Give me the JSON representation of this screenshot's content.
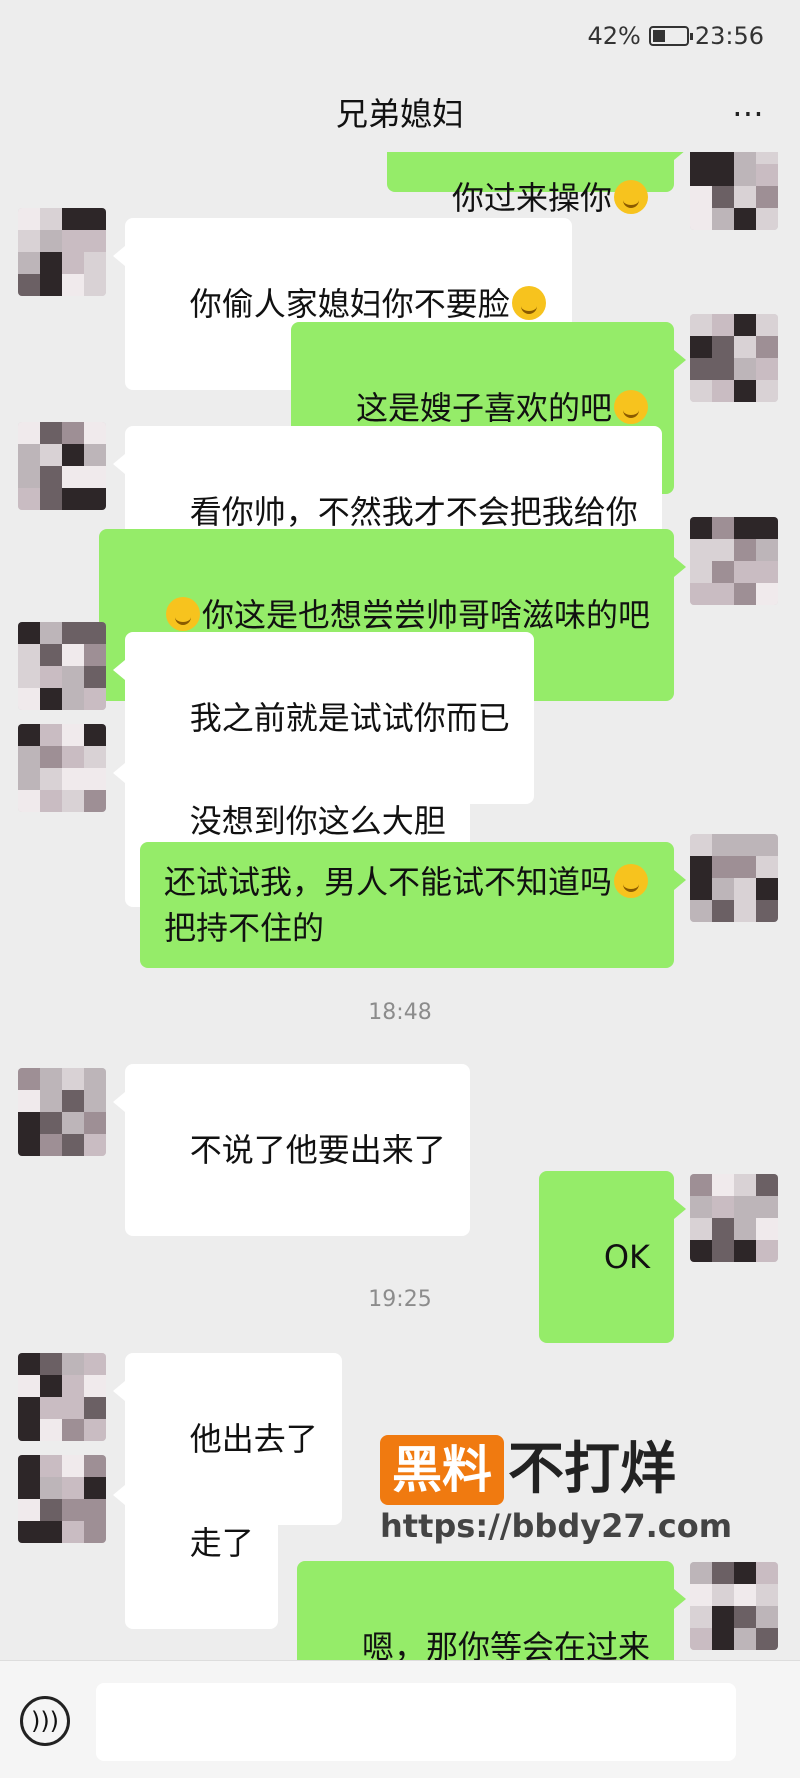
{
  "status_bar": {
    "battery": "42%",
    "time": "23:56"
  },
  "header": {
    "title": "兄弟媳妇",
    "more": "⋯"
  },
  "messages": [
    {
      "side": "right",
      "text": "你过来操你"
    },
    {
      "side": "left",
      "text": "你偷人家媳妇你不要脸"
    },
    {
      "side": "right",
      "text": "这是嫂子喜欢的吧"
    },
    {
      "side": "left",
      "text": "看你帅，不然我才不会把我给你"
    },
    {
      "side": "right",
      "text": "你这是也想尝尝帅哥啥滋味的吧"
    },
    {
      "side": "left",
      "text": "我之前就是试试你而已"
    },
    {
      "side": "left",
      "text": "没想到你这么大胆"
    },
    {
      "side": "right",
      "text": "还试试我，男人不能试不知道吗"
    },
    {
      "side": "right",
      "text": "把持不住的"
    },
    {
      "side": "left",
      "text": "不说了他要出来了"
    },
    {
      "side": "right",
      "text": "OK"
    },
    {
      "side": "left",
      "text": "他出去了"
    },
    {
      "side": "left",
      "text": "走了"
    },
    {
      "side": "right",
      "text": "嗯，那你等会在过来"
    }
  ],
  "timestamps": [
    "18:48",
    "19:25"
  ],
  "watermark": {
    "badge": "黑料",
    "text": "不打烊",
    "url": "https://bbdy27.com"
  },
  "icons": {
    "voice": "voice-icon",
    "more": "more-icon",
    "emoji": "emoji-icon"
  }
}
